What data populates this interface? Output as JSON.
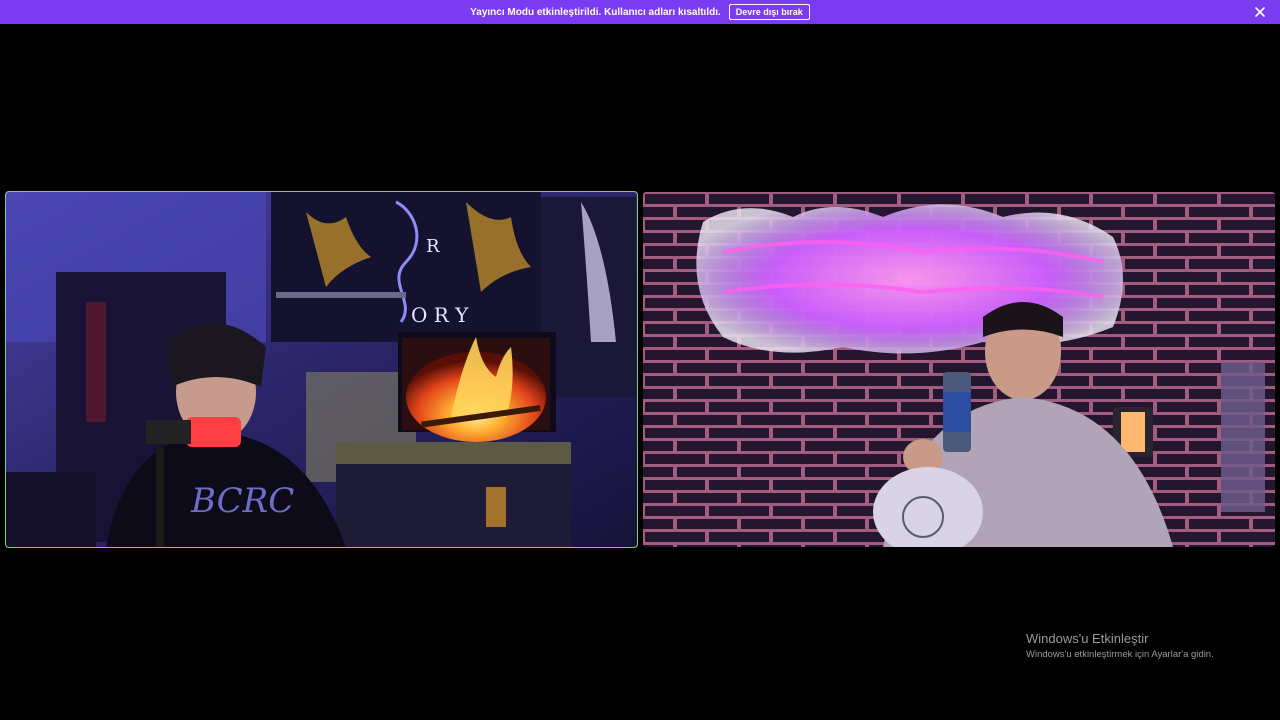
{
  "banner": {
    "message": "Yayıncı Modu etkinleştirildi. Kullanıcı adları kısaltıldı.",
    "disable_label": "Devre dışı bırak",
    "close_icon": "close-icon",
    "accent": "#7b3bf0"
  },
  "video_tiles": [
    {
      "speaking": true,
      "highlight_color": "#7ccf80"
    },
    {
      "speaking": false
    }
  ],
  "windows_activation": {
    "title": "Windows'u Etkinleştir",
    "subtitle": "Windows'u etkinleştirmek için Ayarlar'a gidin."
  }
}
